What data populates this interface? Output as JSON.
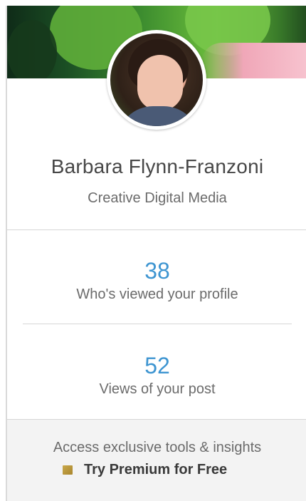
{
  "profile": {
    "name": "Barbara Flynn-Franzoni",
    "headline": "Creative Digital Media"
  },
  "stats": [
    {
      "value": "38",
      "label": "Who's viewed your profile"
    },
    {
      "value": "52",
      "label": "Views of your post"
    }
  ],
  "premium": {
    "tagline": "Access exclusive tools & insights",
    "cta_label": "Try Premium for Free",
    "badge_icon": "premium-badge-icon",
    "badge_color": "#c9a84a"
  },
  "colors": {
    "stat_number": "#3e95d1",
    "text_primary": "#474747",
    "text_secondary": "#6b6b6b"
  }
}
